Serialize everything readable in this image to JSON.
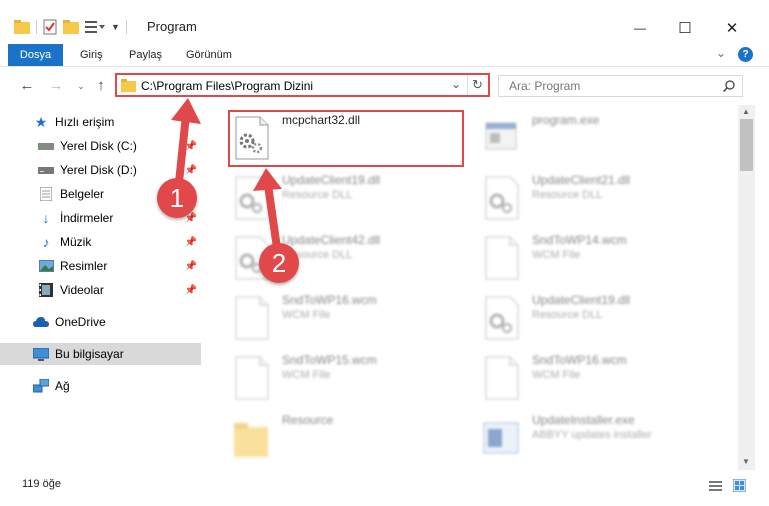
{
  "window": {
    "title": "Program",
    "minimize_glyph": "—",
    "maximize_glyph": "☐",
    "close_glyph": "✕"
  },
  "ribbon": {
    "tabs": [
      {
        "label": "Dosya",
        "active": true
      },
      {
        "label": "Giriş"
      },
      {
        "label": "Paylaş"
      },
      {
        "label": "Görünüm"
      }
    ]
  },
  "navigation": {
    "address": "C:\\Program Files\\Program Dizini",
    "search_placeholder": "Ara: Program"
  },
  "sidebar": {
    "items": [
      {
        "label": "Hızlı erişim",
        "icon": "star-icon"
      },
      {
        "label": "Yerel Disk (C:)",
        "icon": "drive-icon",
        "pinned": true
      },
      {
        "label": "Yerel Disk (D:)",
        "icon": "drive-icon",
        "pinned": true
      },
      {
        "label": "Belgeler",
        "icon": "documents-icon",
        "pinned": true
      },
      {
        "label": "İndirmeler",
        "icon": "download-icon",
        "pinned": true
      },
      {
        "label": "Müzik",
        "icon": "music-icon",
        "pinned": true
      },
      {
        "label": "Resimler",
        "icon": "pictures-icon",
        "pinned": true
      },
      {
        "label": "Videolar",
        "icon": "videos-icon",
        "pinned": true
      },
      {
        "label": "OneDrive",
        "icon": "cloud-icon"
      },
      {
        "label": "Bu bilgisayar",
        "icon": "computer-icon",
        "selected": true
      },
      {
        "label": "Ağ",
        "icon": "network-icon"
      }
    ]
  },
  "files": [
    {
      "name": "mcpchart32.dll",
      "type": "",
      "icon": "dll-gear-icon"
    },
    {
      "name": "program.exe",
      "type": "",
      "icon": "exe-icon"
    },
    {
      "name": "UpdateClient19.dll",
      "type": "Resource DLL",
      "icon": "dll-gear-icon"
    },
    {
      "name": "UpdateClient21.dll",
      "type": "Resource DLL",
      "icon": "dll-gear-icon"
    },
    {
      "name": "UpdateClient42.dll",
      "type": "Resource DLL",
      "icon": "dll-gear-icon"
    },
    {
      "name": "SndToWP14.wcm",
      "type": "WCM File",
      "icon": "file-icon"
    },
    {
      "name": "SndToWP16.wcm",
      "type": "WCM File",
      "icon": "file-icon"
    },
    {
      "name": "UpdateClient19.dll",
      "type": "Resource DLL",
      "icon": "dll-gear-icon"
    },
    {
      "name": "SndToWP15.wcm",
      "type": "WCM File",
      "icon": "file-icon"
    },
    {
      "name": "SndToWP16.wcm",
      "type": "WCM File",
      "icon": "file-icon"
    },
    {
      "name": "Resource",
      "type": "",
      "icon": "folder-icon"
    },
    {
      "name": "UpdateInstaller.exe",
      "type": "ABBYY updates installer",
      "icon": "installer-icon"
    }
  ],
  "status": {
    "item_count": "119 öğe"
  },
  "callouts": {
    "first": "1",
    "second": "2"
  },
  "colors": {
    "accent": "#1a73c8",
    "highlight": "#e0484a"
  }
}
